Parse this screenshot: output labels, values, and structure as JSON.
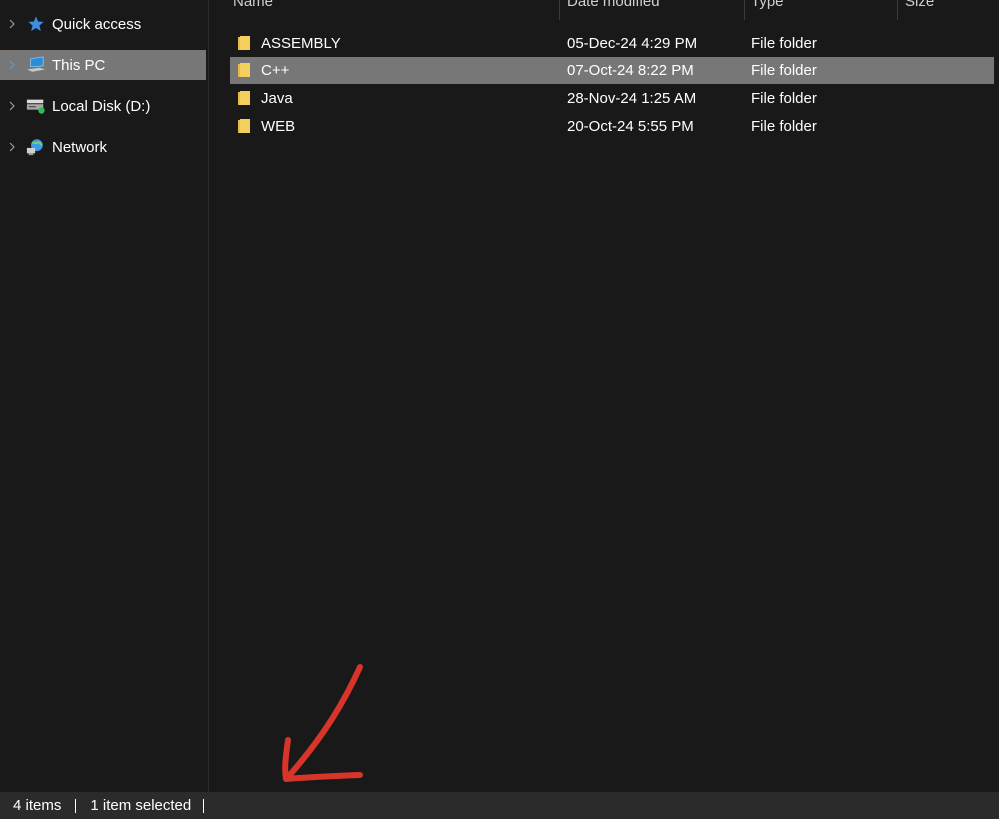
{
  "sidebar": {
    "items": [
      {
        "label": "Quick access",
        "icon": "star-icon",
        "selected": false
      },
      {
        "label": "This PC",
        "icon": "computer-icon",
        "selected": true
      },
      {
        "label": "Local Disk (D:)",
        "icon": "drive-icon",
        "selected": false
      },
      {
        "label": "Network",
        "icon": "network-icon",
        "selected": false
      }
    ]
  },
  "columns": {
    "name": "Name",
    "date": "Date modified",
    "type": "Type",
    "size": "Size"
  },
  "files": [
    {
      "name": "ASSEMBLY",
      "date": "05-Dec-24 4:29 PM",
      "type": "File folder",
      "selected": false
    },
    {
      "name": "C++",
      "date": "07-Oct-24 8:22 PM",
      "type": "File folder",
      "selected": true
    },
    {
      "name": "Java",
      "date": "28-Nov-24 1:25 AM",
      "type": "File folder",
      "selected": false
    },
    {
      "name": "WEB",
      "date": "20-Oct-24 5:55 PM",
      "type": "File folder",
      "selected": false
    }
  ],
  "status": {
    "count": "4 items",
    "selection": "1 item selected"
  },
  "colors": {
    "background": "#191919",
    "selection": "#777777",
    "status_bar": "#2b2b2b",
    "folder": "#f5cf5b",
    "annotation_arrow": "#d8352a",
    "accent": "#4aa3e8"
  }
}
